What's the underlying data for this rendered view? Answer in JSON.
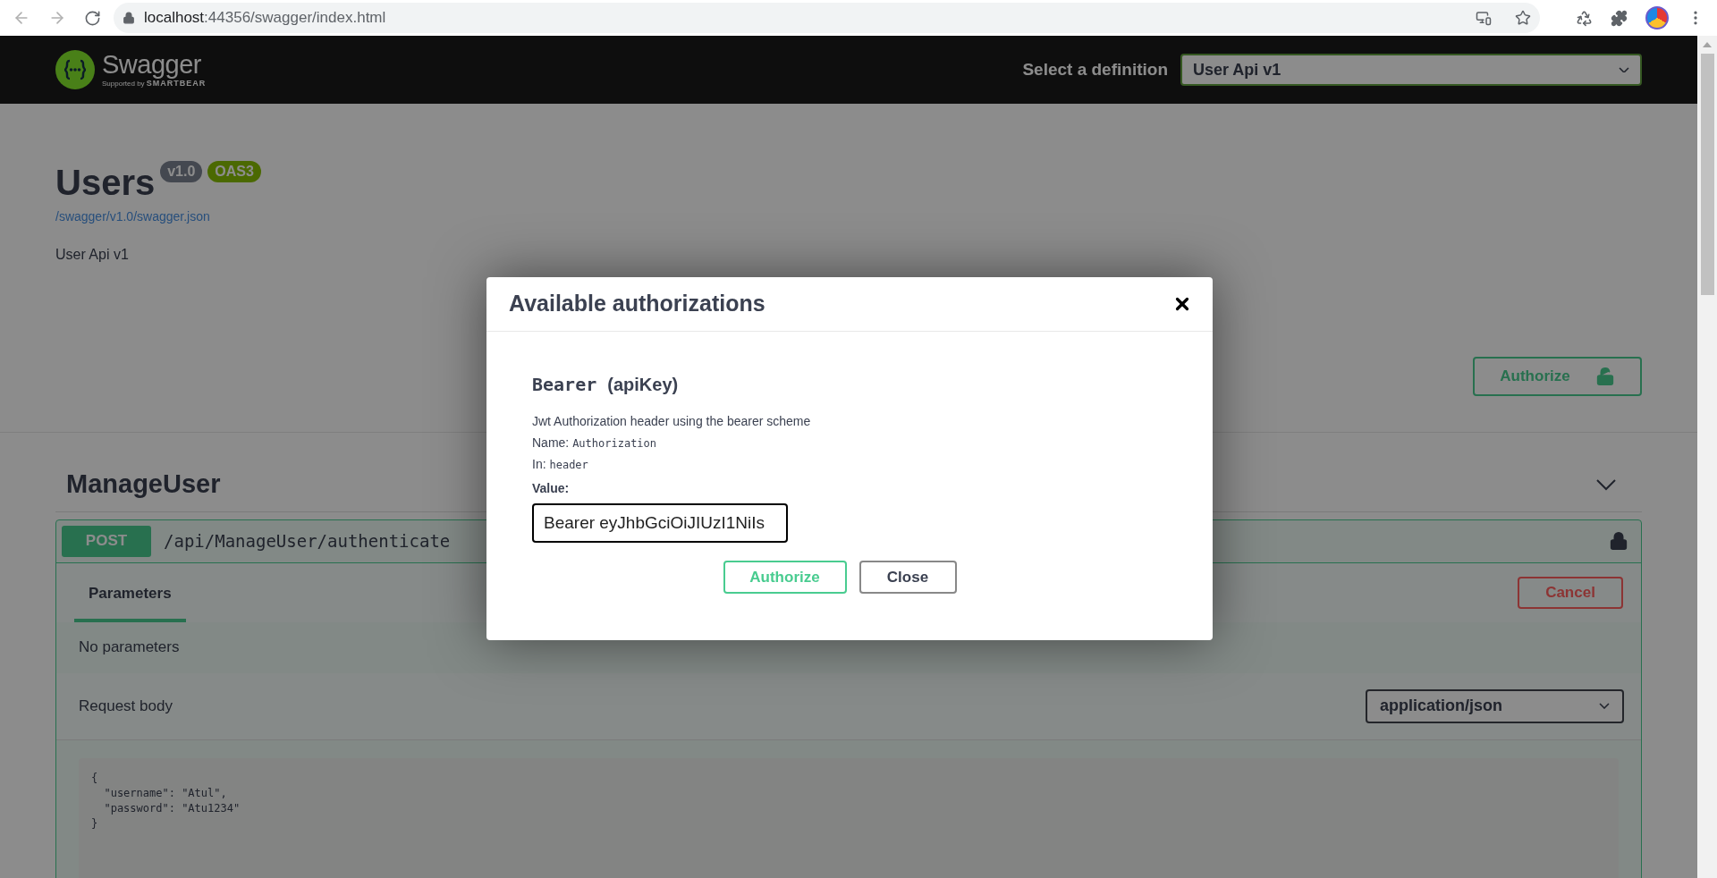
{
  "browser": {
    "url_host": "localhost",
    "url_path": ":44356/swagger/index.html"
  },
  "topbar": {
    "logo_text": "Swagger",
    "logo_sub": "Supported by",
    "logo_brand": "SMARTBEAR",
    "definition_label": "Select a definition",
    "definition_value": "User Api v1"
  },
  "info": {
    "title": "Users",
    "badges": [
      {
        "text": "v1.0",
        "kind": "version"
      },
      {
        "text": "OAS3",
        "kind": "oas"
      }
    ],
    "link": "/swagger/v1.0/swagger.json",
    "description": "User Api v1"
  },
  "authorize_button": "Authorize",
  "section": {
    "name": "ManageUser",
    "expanded": true
  },
  "operation": {
    "method": "POST",
    "path": "/api/ManageUser/authenticate",
    "tabs": [
      {
        "label": "Parameters",
        "selected": true
      }
    ],
    "cancel": "Cancel",
    "no_params": "No parameters",
    "request_body_label": "Request body",
    "content_type": "application/json",
    "body_lines": [
      "{",
      "  \"username\": \"Atul\",",
      "  \"password\": \"Atu1234\"",
      "}"
    ]
  },
  "modal": {
    "title": "Available authorizations",
    "scheme_name": "Bearer",
    "scheme_type": "(apiKey)",
    "description": "Jwt Authorization header using the bearer scheme",
    "name_label": "Name:",
    "name_value": "Authorization",
    "in_label": "In:",
    "in_value": "header",
    "value_label": "Value:",
    "value": "Bearer eyJhbGciOiJIUzI1NiIs",
    "buttons": [
      {
        "label": "Authorize",
        "kind": "primary"
      },
      {
        "label": "Close",
        "kind": "secondary"
      }
    ]
  }
}
